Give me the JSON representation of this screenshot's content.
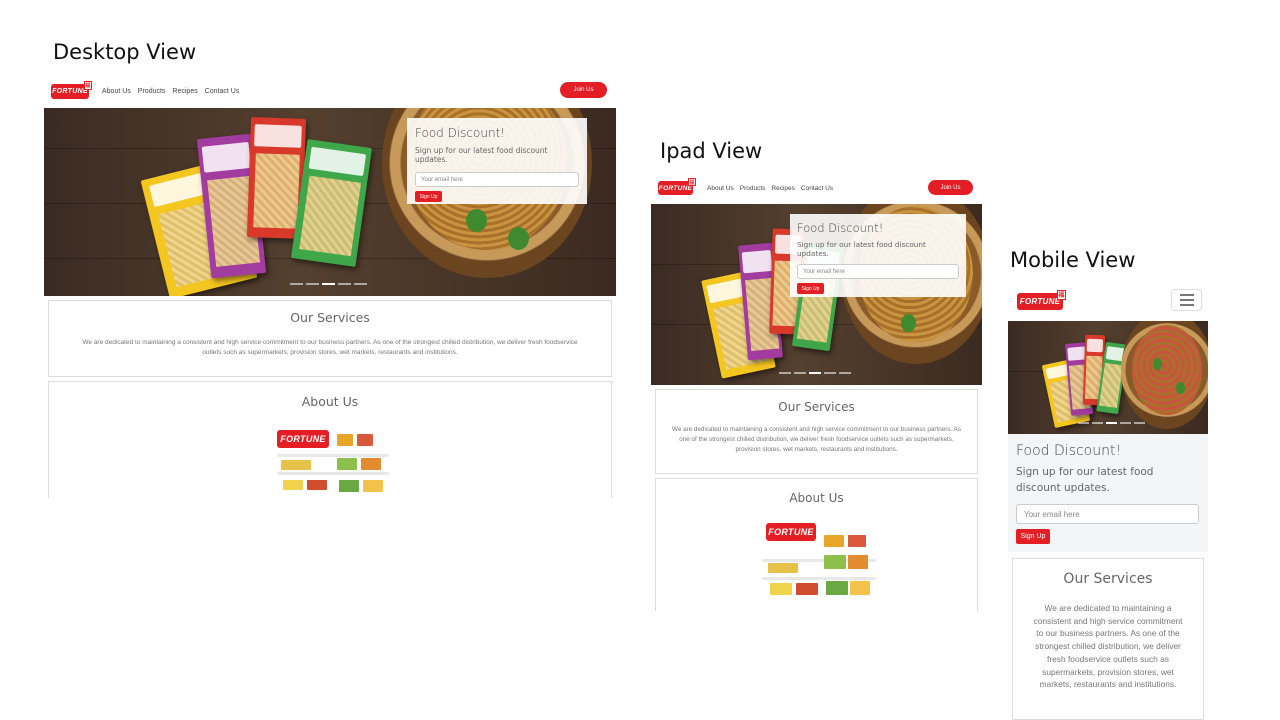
{
  "labels": {
    "desktop": "Desktop View",
    "ipad": "Ipad View",
    "mobile": "Mobile View"
  },
  "brand": {
    "logo_text": "FORTUNE",
    "seal": "福",
    "color": "#e31e25"
  },
  "nav": {
    "links": [
      "About Us",
      "Products",
      "Recipes",
      "Contact Us"
    ],
    "join": "Join Us"
  },
  "discount": {
    "title": "Food Discount!",
    "subtitle": "Sign up for our latest food discount updates.",
    "email_placeholder": "Your email here",
    "signup": "Sign Up"
  },
  "services": {
    "title": "Our Services",
    "text": "We are dedicated to maintaining a consistent and high service commitment to our business partners. As one of the strongest chilled distribution, we deliver fresh foodservice outlets such as supermarkets, provision stores, wet markets, restaurants and institutions."
  },
  "about": {
    "title": "About Us"
  },
  "carousel": {
    "slides": 5,
    "active_index": 2
  },
  "icons": {
    "menu": "hamburger-menu-icon",
    "logo": "fortune-logo"
  }
}
